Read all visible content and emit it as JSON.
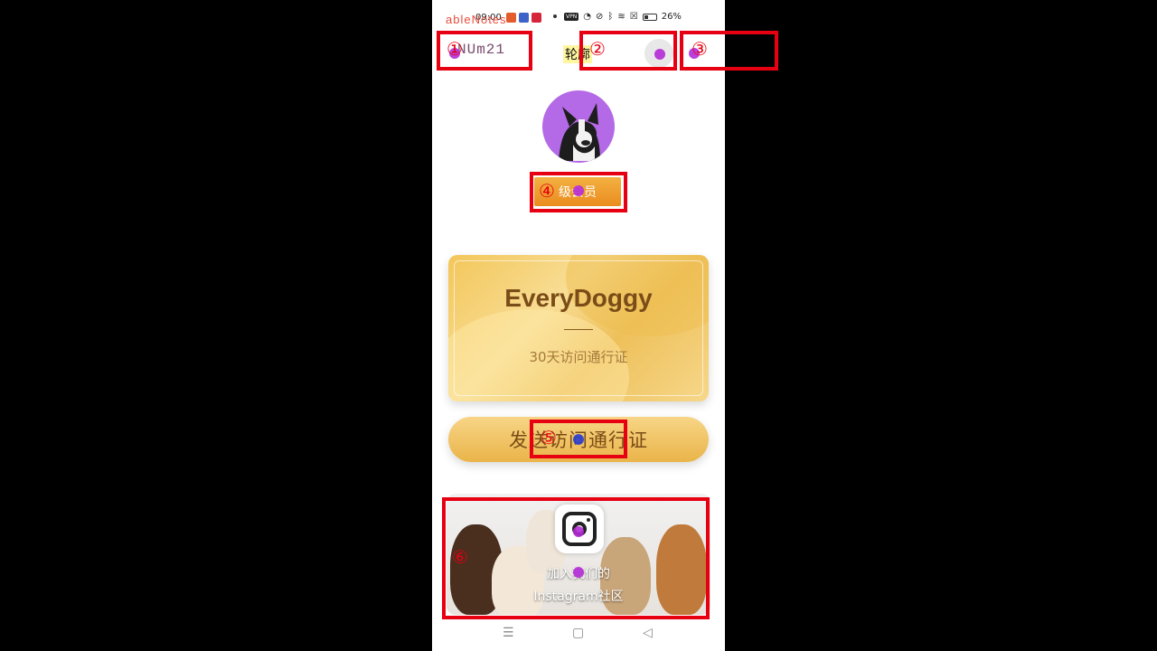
{
  "status_bar": {
    "time": "09:00",
    "vpn": "VPN",
    "battery": "26%"
  },
  "overlay_app_name": "ableNotes",
  "header": {
    "user_id": "NUm21",
    "title": "轮廓"
  },
  "profile": {
    "member_badge": "级会员"
  },
  "pass_card": {
    "brand": "EveryDoggy",
    "subtitle": "30天访问通行证"
  },
  "send_button": {
    "label": "发送访问通行证"
  },
  "community": {
    "line1": "加入我们的",
    "line2": "Instagram社区"
  },
  "nav_bar": {
    "menu": "☰",
    "home": "▢",
    "back": "◁"
  },
  "annotations": [
    "①",
    "②",
    "③",
    "④",
    "⑤",
    "⑥"
  ],
  "colors": {
    "annotation": "#e60012",
    "badge": "#ee9a2a",
    "gold": "#f0c35c",
    "brand_text": "#7a4c17",
    "avatar_bg": "#b469e6"
  }
}
